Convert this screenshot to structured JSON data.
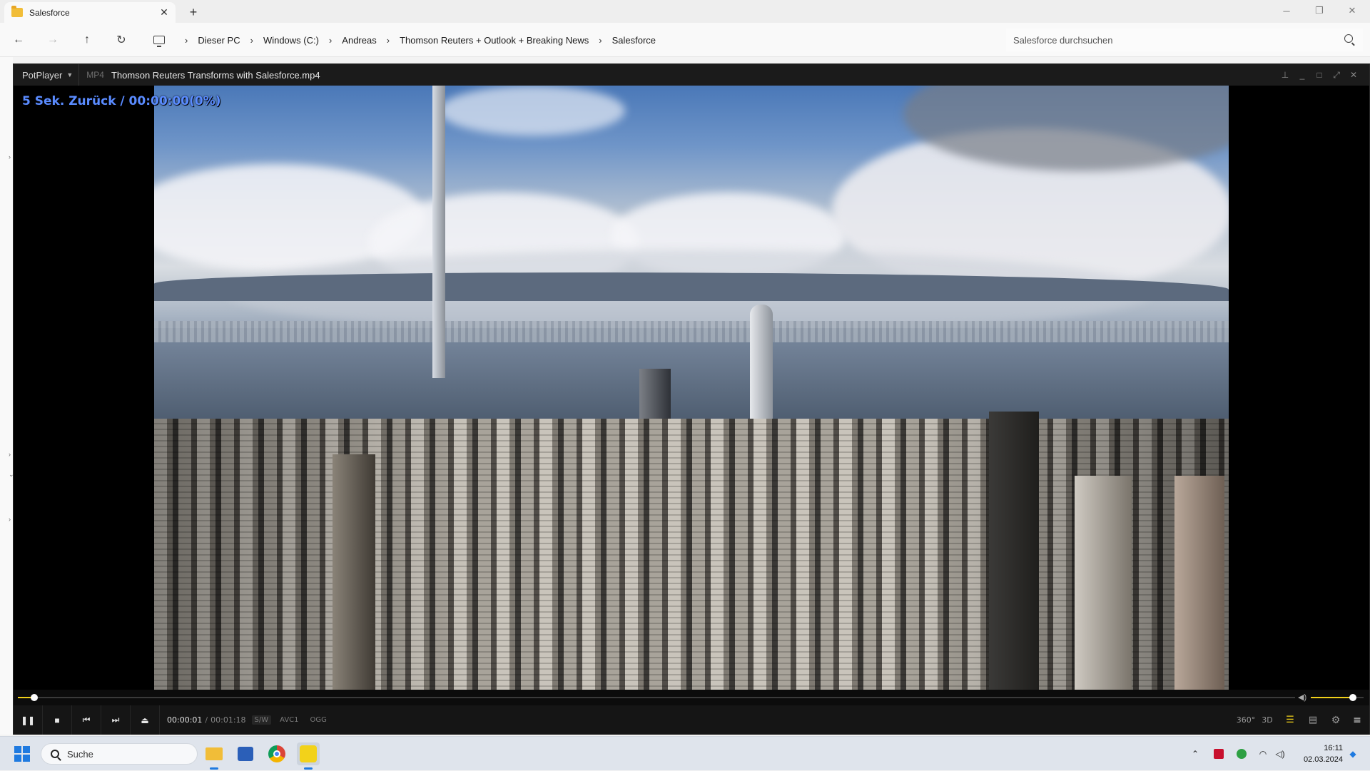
{
  "explorer": {
    "tab_title": "Salesforce",
    "new_tab": "+",
    "tab_close": "✕",
    "breadcrumb": [
      "Dieser PC",
      "Windows (C:)",
      "Andreas",
      "Thomson Reuters + Outlook + Breaking News",
      "Salesforce"
    ],
    "search_placeholder": "Salesforce durchsuchen"
  },
  "player": {
    "brand": "PotPlayer",
    "format": "MP4",
    "filename": "Thomson Reuters Transforms with Salesforce.mp4",
    "osd_text": "5  Sek. Zurück / 00:00:00(0%)",
    "time_current": "00:00:01",
    "time_separator": "/",
    "time_total": "00:01:18",
    "tags": [
      "S/W",
      "AVC1",
      "OGG"
    ],
    "seek_fraction": 0.013,
    "volume_fraction": 0.8,
    "right_controls": [
      "360°",
      "3D"
    ]
  },
  "taskbar": {
    "search_label": "Suche",
    "time": "16:11",
    "date": "02.03.2024"
  },
  "colors": {
    "accent_yellow": "#f2d21a",
    "osd_blue": "#5a8cff",
    "windows_blue": "#1f7ae0"
  }
}
